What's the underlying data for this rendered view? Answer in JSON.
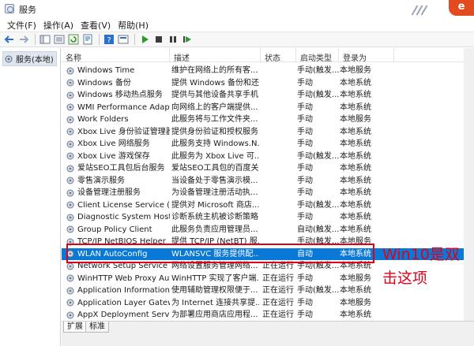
{
  "window": {
    "title": "服务"
  },
  "menu": [
    "文件(F)",
    "操作(A)",
    "查看(V)",
    "帮助(H)"
  ],
  "brand": {
    "logo_text": "e",
    "accent": "#0a78d7",
    "annotation_color": "#e0001a"
  },
  "tree": {
    "root_label": "服务(本地)"
  },
  "columns": {
    "name": "名称",
    "description": "描述",
    "status": "状态",
    "startup": "启动类型",
    "logon": "登录为"
  },
  "rows": [
    {
      "name": "Windows Time",
      "desc": "维护在网络上的所有客...",
      "status": "",
      "start": "手动(触发...",
      "logon": "本地服务"
    },
    {
      "name": "Windows 备份",
      "desc": "提供 Windows 备份和还...",
      "status": "",
      "start": "手动",
      "logon": "本地系统"
    },
    {
      "name": "Windows 移动热点服务",
      "desc": "提供与其他设备共享手机...",
      "status": "",
      "start": "手动(触发...",
      "logon": "本地系统"
    },
    {
      "name": "WMI Performance Adapt...",
      "desc": "向网络上的客户端提供...",
      "status": "",
      "start": "手动",
      "logon": "本地系统"
    },
    {
      "name": "Work Folders",
      "desc": "此服务将与工作文件夹...",
      "status": "",
      "start": "手动",
      "logon": "本地服务"
    },
    {
      "name": "Xbox Live 身份验证管理器",
      "desc": "提供身份验证和授权服务...",
      "status": "",
      "start": "手动",
      "logon": "本地系统"
    },
    {
      "name": "Xbox Live 网络服务",
      "desc": "此服务支持 Windows.N...",
      "status": "",
      "start": "手动",
      "logon": "本地系统"
    },
    {
      "name": "Xbox Live 游戏保存",
      "desc": "此服务为 Xbox Live 可...",
      "status": "",
      "start": "手动(触发...",
      "logon": "本地系统"
    },
    {
      "name": "爱站SEO工具包后台服务",
      "desc": "爱站SEO工具包的百度关...",
      "status": "",
      "start": "手动",
      "logon": "本地系统"
    },
    {
      "name": "零售演示服务",
      "desc": "当设备处于零售演示模...",
      "status": "",
      "start": "手动",
      "logon": "本地系统"
    },
    {
      "name": "设备管理注册服务",
      "desc": "为设备管理注册活动执...",
      "status": "",
      "start": "手动",
      "logon": "本地系统"
    },
    {
      "name": "Client License Service (Cli...",
      "desc": "提供对 Microsoft 商店...",
      "status": "",
      "start": "手动(触发...",
      "logon": "本地系统"
    },
    {
      "name": "Diagnostic System Host",
      "desc": "诊断系统主机被诊断策略...",
      "status": "",
      "start": "手动",
      "logon": "本地系统"
    },
    {
      "name": "Group Policy Client",
      "desc": "此服务负责应用管理员...",
      "status": "",
      "start": "自动(触发...",
      "logon": "本地系统"
    },
    {
      "name": "TCP/IP NetBIOS Helper",
      "desc": "提供 TCP/IP (NetBT) 服...",
      "status": "",
      "start": "手动(触发...",
      "logon": "本地服务"
    },
    {
      "name": "WLAN AutoConfig",
      "desc": "WLANSVC 服务提供配...",
      "status": "",
      "start": "自动",
      "logon": "本地系统",
      "selected": true
    },
    {
      "name": "Network Setup Service",
      "desc": "网络设置服务管理网络...",
      "status": "正在运行",
      "start": "手动(触发...",
      "logon": "本地系统"
    },
    {
      "name": "WinHTTP Web Proxy Aut...",
      "desc": "WinHTTP 实现了客户端...",
      "status": "正在运行",
      "start": "手动",
      "logon": "本地服务"
    },
    {
      "name": "Application Information",
      "desc": "使用辅助管理权限便于...",
      "status": "正在运行",
      "start": "手动(触发...",
      "logon": "本地系统"
    },
    {
      "name": "Application Layer Gatewa...",
      "desc": "为 Internet 连接共享提...",
      "status": "正在运行",
      "start": "手动",
      "logon": "本地服务"
    },
    {
      "name": "AppX Deployment Servic...",
      "desc": "为部署应用商店应用程...",
      "status": "正在运行",
      "start": "手动",
      "logon": "本地系统"
    }
  ],
  "annotation": {
    "text": "Win10是双击这项"
  },
  "tabs": [
    "扩展",
    "标准"
  ]
}
